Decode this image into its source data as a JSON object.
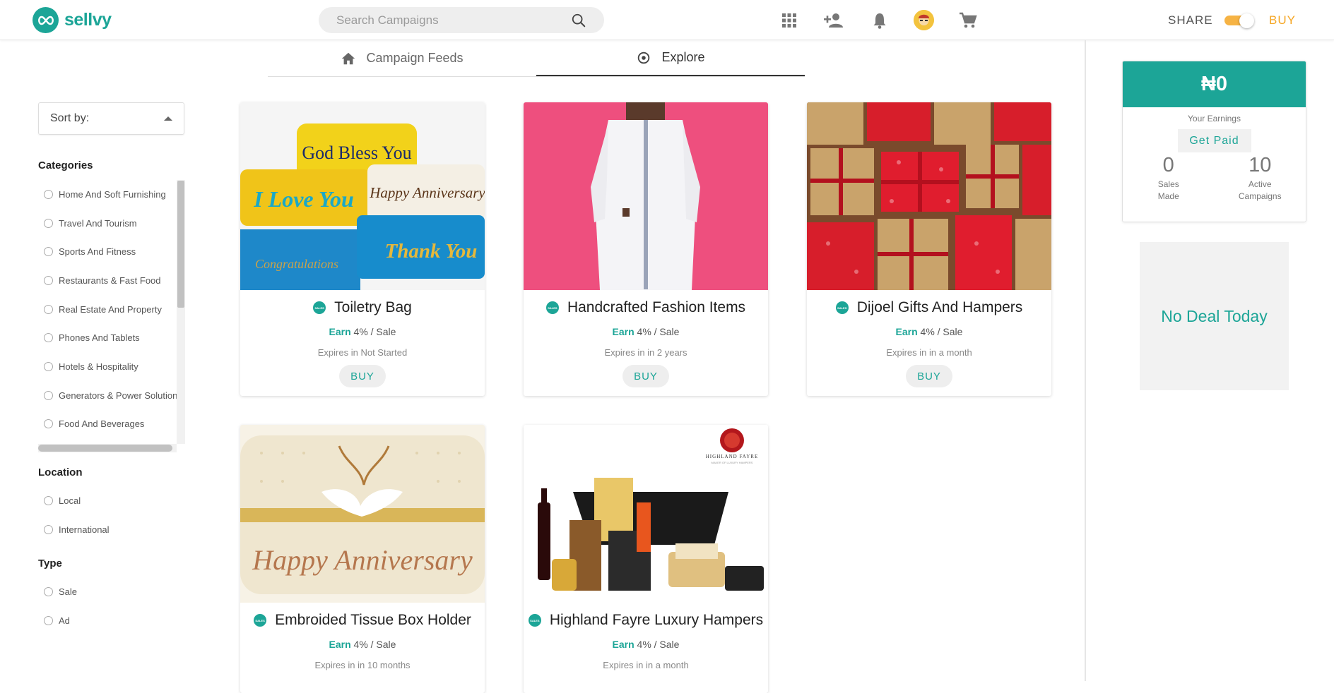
{
  "header": {
    "logo_text": "sellvy",
    "search_placeholder": "Search Campaigns",
    "icons": [
      "apps-grid-icon",
      "add-person-icon",
      "bell-icon",
      "avatar",
      "cart-icon"
    ],
    "share_label": "SHARE",
    "buy_label": "BUY",
    "toggle_color": "#f5a623"
  },
  "tabs": [
    {
      "label": "Campaign Feeds",
      "icon": "home-icon",
      "active": false
    },
    {
      "label": "Explore",
      "icon": "target-icon",
      "active": true
    }
  ],
  "sidebar": {
    "sort_label": "Sort by:",
    "categories_title": "Categories",
    "categories": [
      "Home And Soft Furnishing",
      "Travel And Tourism",
      "Sports And Fitness",
      "Restaurants & Fast Food",
      "Real Estate And Property",
      "Phones And Tablets",
      "Hotels & Hospitality",
      "Generators & Power Solutions",
      "Food And Beverages"
    ],
    "location_title": "Location",
    "locations": [
      "Local",
      "International"
    ],
    "type_title": "Type",
    "types": [
      "Sale",
      "Ad"
    ]
  },
  "cards": [
    {
      "title": "Toiletry Bag",
      "earn": "Earn",
      "rate": "4% / Sale",
      "expires": "Expires in Not Started",
      "buy": "BUY",
      "badge": "SALES",
      "img_texts": [
        "God Bless You",
        "I Love You",
        "Happy Anniversary",
        "Congratulations",
        "Thank You"
      ]
    },
    {
      "title": "Handcrafted Fashion Items",
      "earn": "Earn",
      "rate": "4% / Sale",
      "expires": "Expires in in 2 years",
      "buy": "BUY",
      "badge": "SALES"
    },
    {
      "title": "Dijoel Gifts And Hampers",
      "earn": "Earn",
      "rate": "4% / Sale",
      "expires": "Expires in in a month",
      "buy": "BUY",
      "badge": "SALES"
    },
    {
      "title": "Embroided Tissue Box Holder",
      "earn": "Earn",
      "rate": "4% / Sale",
      "expires": "Expires in in 10 months",
      "buy": "BUY",
      "badge": "SALES",
      "img_texts": [
        "Happy Anniversary"
      ]
    },
    {
      "title": "Highland Fayre Luxury Hampers",
      "earn": "Earn",
      "rate": "4% / Sale",
      "expires": "Expires in in a month",
      "buy": "BUY",
      "badge": "SALES",
      "img_texts": [
        "HIGHLAND FAYRE",
        "MAKER OF LUXURY HAMPERS"
      ]
    }
  ],
  "earnings": {
    "amount": "₦0",
    "label": "Your Earnings",
    "get_paid": "Get Paid",
    "sales_made_value": "0",
    "sales_made_label": "Sales Made",
    "active_campaigns_value": "10",
    "active_campaigns_label": "Active Campaigns"
  },
  "deal_text": "No Deal Today",
  "colors": {
    "brand": "#1ca597",
    "accent": "#f5a623"
  }
}
